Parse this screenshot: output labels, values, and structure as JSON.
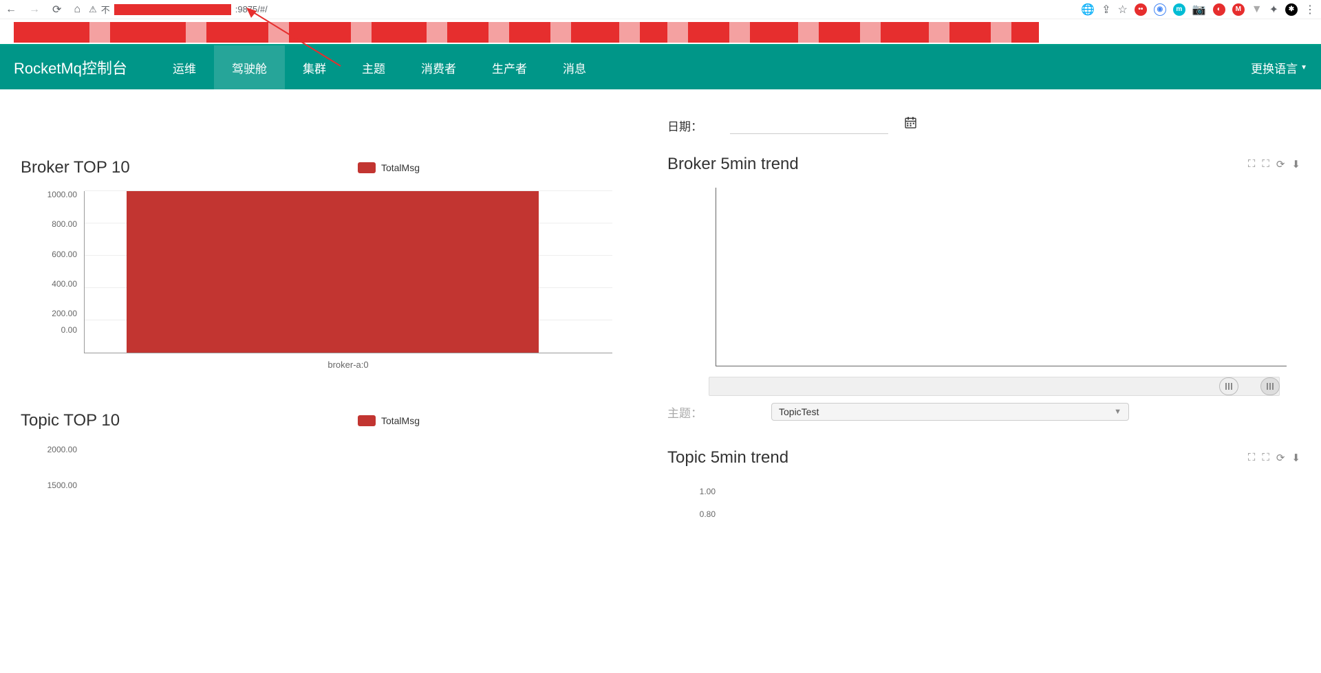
{
  "browser": {
    "url_suffix": ":9875/#/",
    "warn_prefix": "不"
  },
  "nav": {
    "brand": "RocketMq控制台",
    "items": [
      "运维",
      "驾驶舱",
      "集群",
      "主题",
      "消费者",
      "生产者",
      "消息"
    ],
    "active_index": 1,
    "lang": "更换语言"
  },
  "date": {
    "label": "日期："
  },
  "topic_select": {
    "label": "主题：",
    "value": "TopicTest"
  },
  "panels": {
    "broker_top": {
      "title": "Broker TOP 10",
      "legend": "TotalMsg"
    },
    "broker_trend": {
      "title": "Broker 5min trend"
    },
    "topic_top": {
      "title": "Topic TOP 10",
      "legend": "TotalMsg"
    },
    "topic_trend": {
      "title": "Topic 5min trend"
    }
  },
  "chart_data": [
    {
      "type": "bar",
      "title": "Broker TOP 10",
      "categories": [
        "broker-a:0"
      ],
      "values": [
        1000
      ],
      "ylim": [
        0,
        1000
      ],
      "yticks": [
        0,
        200,
        400,
        600,
        800,
        1000
      ],
      "series_name": "TotalMsg"
    },
    {
      "type": "line",
      "title": "Broker 5min trend",
      "x": [],
      "series": []
    },
    {
      "type": "bar",
      "title": "Topic TOP 10",
      "categories": [],
      "values": [],
      "ylim": [
        0,
        2000
      ],
      "yticks": [
        1500,
        2000
      ],
      "series_name": "TotalMsg"
    },
    {
      "type": "line",
      "title": "Topic 5min trend",
      "ylim": [
        0,
        1
      ],
      "yticks": [
        0.8,
        1.0
      ],
      "x": [],
      "series": []
    }
  ]
}
